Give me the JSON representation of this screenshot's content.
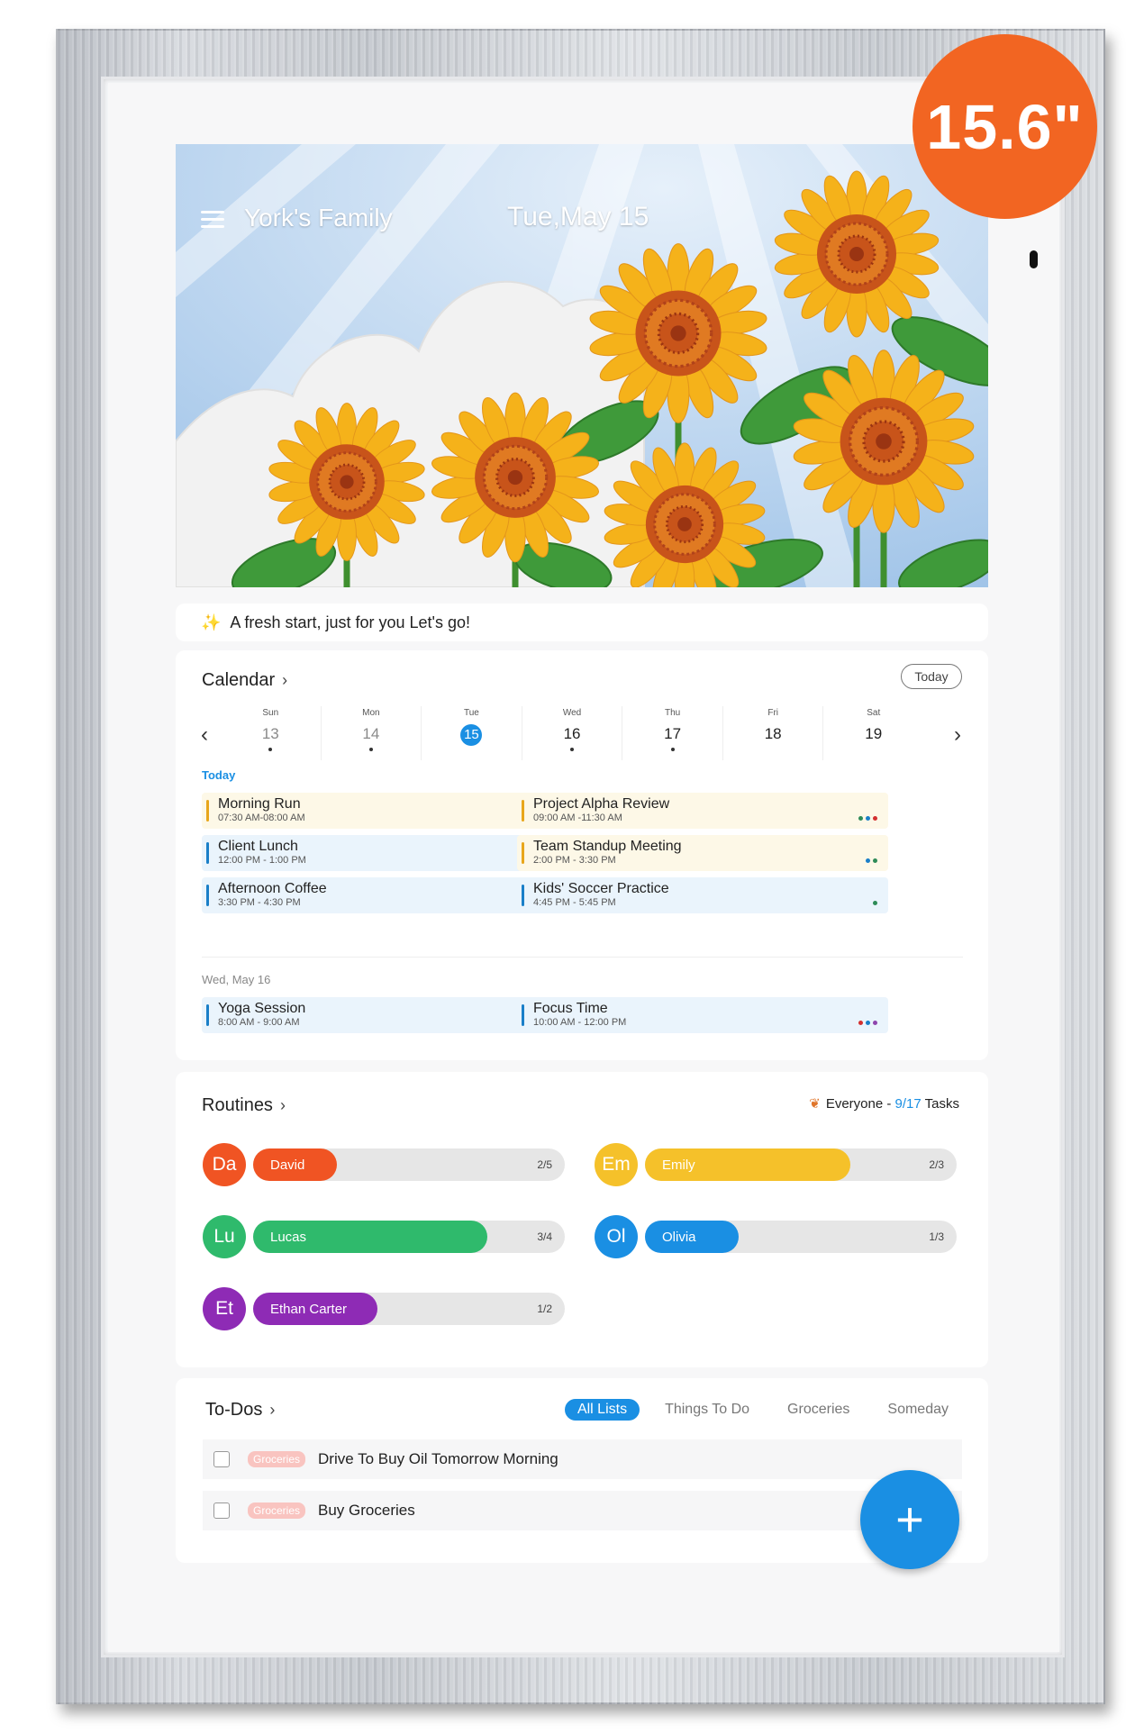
{
  "badge": {
    "size_label": "15.6\""
  },
  "header": {
    "family_name": "York's Family",
    "date": "Tue,May 15"
  },
  "greeting": {
    "text": "A fresh start, just for you  Let's go!"
  },
  "calendar": {
    "title": "Calendar",
    "today_button": "Today",
    "days": [
      {
        "name": "Sun",
        "num": "13",
        "dot": true,
        "dim": true
      },
      {
        "name": "Mon",
        "num": "14",
        "dot": true,
        "dim": true
      },
      {
        "name": "Tue",
        "num": "15",
        "dot": false,
        "selected": true
      },
      {
        "name": "Wed",
        "num": "16",
        "dot": true
      },
      {
        "name": "Thu",
        "num": "17",
        "dot": true
      },
      {
        "name": "Fri",
        "num": "18",
        "dot": false
      },
      {
        "name": "Sat",
        "num": "19",
        "dot": false
      }
    ],
    "today_label": "Today",
    "today_events": [
      {
        "title": "Morning Run",
        "time": "07:30 AM-08:00 AM",
        "color": "yellow",
        "dots": [
          "#e85d9a",
          "#d32f2f"
        ]
      },
      {
        "title": "Project Alpha Review",
        "time": "09:00 AM -11:30 AM",
        "color": "yellow",
        "dots": [
          "#2e8b57",
          "#1a7fc8",
          "#d32f2f"
        ]
      },
      {
        "title": "Client Lunch",
        "time": "12:00 PM - 1:00 PM",
        "color": "blue",
        "dots": [
          "#1a7fc8",
          "#2e8b57",
          "#1a3c8c",
          "#e8a61b"
        ]
      },
      {
        "title": "Team Standup Meeting",
        "time": "2:00 PM - 3:30 PM",
        "color": "yellow",
        "dots": [
          "#1a7fc8",
          "#2e8b57"
        ]
      },
      {
        "title": "Afternoon Coffee",
        "time": "3:30 PM - 4:30 PM",
        "color": "blue",
        "dots": [
          "#2e8b57",
          "#e8a61b"
        ]
      },
      {
        "title": "Kids' Soccer Practice",
        "time": "4:45 PM - 5:45 PM",
        "color": "blue",
        "dots": [
          "#2e8b57"
        ]
      }
    ],
    "next_date_label": "Wed, May 16",
    "next_events": [
      {
        "title": "Yoga Session",
        "time": "8:00 AM - 9:00 AM",
        "color": "blue",
        "dots": [
          "#2e8b57",
          "#e8a61b"
        ]
      },
      {
        "title": "Focus Time",
        "time": "10:00 AM - 12:00 PM",
        "color": "blue",
        "dots": [
          "#d32f2f",
          "#1a7fc8",
          "#8e44ad"
        ]
      }
    ]
  },
  "routines": {
    "title": "Routines",
    "summary_who": "Everyone",
    "summary_sep": " - ",
    "summary_count": "9/17",
    "summary_unit": " Tasks",
    "people": [
      {
        "initials": "Da",
        "name": "David",
        "count": "2/5",
        "progress": 0.27,
        "color": "#f05423"
      },
      {
        "initials": "Em",
        "name": "Emily",
        "count": "2/3",
        "progress": 0.66,
        "color": "#f5c12a"
      },
      {
        "initials": "Lu",
        "name": "Lucas",
        "count": "3/4",
        "progress": 0.75,
        "color": "#2fba6c"
      },
      {
        "initials": "Ol",
        "name": "Olivia",
        "count": "1/3",
        "progress": 0.3,
        "color": "#1a8fe3"
      },
      {
        "initials": "Et",
        "name": "Ethan Carter",
        "count": "1/2",
        "progress": 0.4,
        "color": "#8e2bb5"
      }
    ]
  },
  "todos": {
    "title": "To-Dos",
    "tabs": [
      {
        "label": "All Lists",
        "active": true
      },
      {
        "label": "Things To Do"
      },
      {
        "label": "Groceries"
      },
      {
        "label": "Someday"
      }
    ],
    "items": [
      {
        "tag": "Groceries",
        "text": "Drive To Buy Oil Tomorrow Morning"
      },
      {
        "tag": "Groceries",
        "text": "Buy Groceries"
      }
    ],
    "fab_label": "+"
  }
}
